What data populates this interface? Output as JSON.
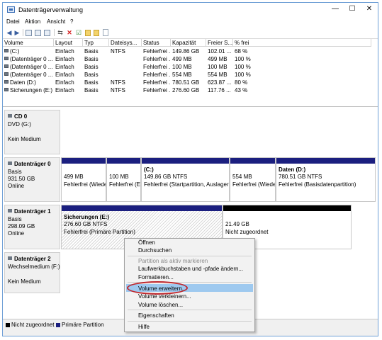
{
  "window": {
    "title": "Datenträgerverwaltung",
    "minimize": "—",
    "maximize": "☐",
    "close": "✕"
  },
  "menu": [
    "Datei",
    "Aktion",
    "Ansicht",
    "?"
  ],
  "toolbar_icons": [
    "back-arrow-icon",
    "forward-arrow-icon",
    "console-icon",
    "help-icon",
    "properties-icon",
    "delete-icon",
    "check-icon",
    "folder-icon",
    "page-icon",
    "refresh-icon"
  ],
  "list": {
    "columns": [
      "Volume",
      "Layout",
      "Typ",
      "Dateisys...",
      "Status",
      "Kapazität",
      "Freier S...",
      "% frei"
    ],
    "rows": [
      [
        "(C:)",
        "Einfach",
        "Basis",
        "NTFS",
        "Fehlerfrei ...",
        "149.86 GB",
        "102.01 ...",
        "68 %"
      ],
      [
        "(Datenträger 0 ...",
        "Einfach",
        "Basis",
        "",
        "Fehlerfrei ...",
        "499 MB",
        "499 MB",
        "100 %"
      ],
      [
        "(Datenträger 0 ...",
        "Einfach",
        "Basis",
        "",
        "Fehlerfrei ...",
        "100 MB",
        "100 MB",
        "100 %"
      ],
      [
        "(Datenträger 0 ...",
        "Einfach",
        "Basis",
        "",
        "Fehlerfrei ...",
        "554 MB",
        "554 MB",
        "100 %"
      ],
      [
        "Daten (D:)",
        "Einfach",
        "Basis",
        "NTFS",
        "Fehlerfrei ...",
        "780.51 GB",
        "623.87 ...",
        "80 %"
      ],
      [
        "Sicherungen (E:)",
        "Einfach",
        "Basis",
        "NTFS",
        "Fehlerfrei ...",
        "276.60 GB",
        "117.76 ...",
        "43 %"
      ]
    ]
  },
  "disks": {
    "cd0": {
      "name": "CD 0",
      "line2": "DVD (G:)",
      "line3": "Kein Medium"
    },
    "disk0": {
      "name": "Datenträger 0",
      "line2": "Basis",
      "line3": "931.50 GB",
      "line4": "Online",
      "partitions": [
        {
          "title": "",
          "size": "499 MB",
          "status": "Fehlerfrei (Wieder"
        },
        {
          "title": "",
          "size": "100 MB",
          "status": "Fehlerfrei (EI"
        },
        {
          "title": "(C:)",
          "size": "149.86 GB NTFS",
          "status": "Fehlerfrei (Startpartition, Auslagerur"
        },
        {
          "title": "",
          "size": "554 MB",
          "status": "Fehlerfrei (Wieder"
        },
        {
          "title": "Daten (D:)",
          "size": "780.51 GB NTFS",
          "status": "Fehlerfrei (Basisdatenpartition)"
        }
      ]
    },
    "disk1": {
      "name": "Datenträger 1",
      "line2": "Basis",
      "line3": "298.09 GB",
      "line4": "Online",
      "partitions": [
        {
          "title": "Sicherungen (E:)",
          "size": "276.60 GB NTFS",
          "status": "Fehlerfrei (Primäre Partition)"
        },
        {
          "title": "",
          "size": "21.49 GB",
          "status": "Nicht zugeordnet"
        }
      ]
    },
    "disk2": {
      "name": "Datenträger 2",
      "line2": "Wechselmedium (F:)",
      "line3": "Kein Medium"
    }
  },
  "legend": {
    "unallocated": "Nicht zugeordnet",
    "primary": "Primäre Partition",
    "unallocated_color": "#000000",
    "primary_color": "#1b1f7f"
  },
  "context_menu": {
    "items": [
      "Öffnen",
      "Durchsuchen",
      "Partition als aktiv markieren",
      "Laufwerkbuchstaben und -pfade ändern...",
      "Formatieren...",
      "Volume erweitern...",
      "Volume verkleinern...",
      "Volume löschen...",
      "Eigenschaften",
      "Hilfe"
    ],
    "highlighted": "Volume erweitern...",
    "highlight_color": "#9ec9ef",
    "annotation_color": "#c0272d"
  }
}
